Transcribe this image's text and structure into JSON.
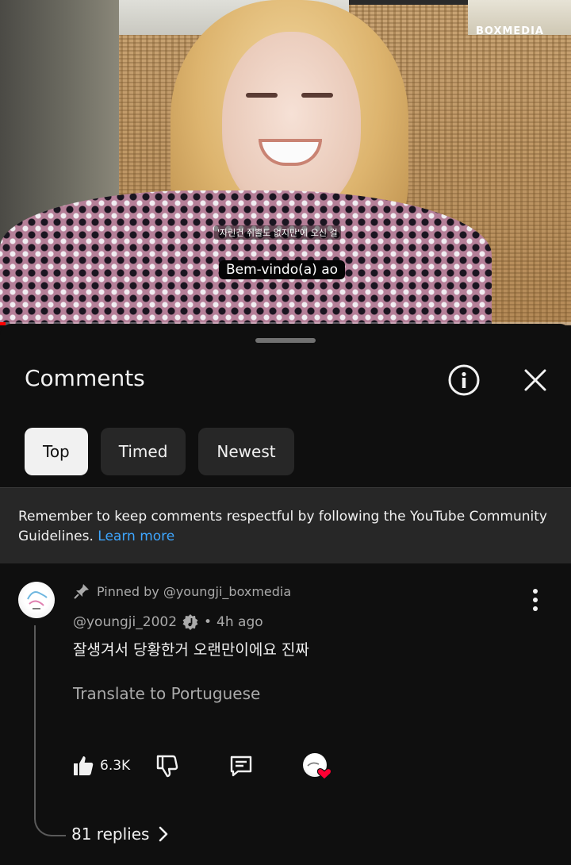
{
  "video": {
    "logo": "BOXMEDIA",
    "subtitle_korean": "'자린건 쥐뿔도 없지만'에 오신 걸",
    "caption": "Bem-vindo(a) ao",
    "progress": 0.01
  },
  "comments_panel": {
    "title": "Comments",
    "info_icon": "info-icon",
    "close_icon": "close-icon",
    "filters": [
      {
        "label": "Top",
        "active": true
      },
      {
        "label": "Timed",
        "active": false
      },
      {
        "label": "Newest",
        "active": false
      }
    ],
    "notice": {
      "text": "Remember to keep comments respectful by following the YouTube Community Guidelines.",
      "link": "Learn more"
    }
  },
  "comment": {
    "pinned_label": "Pinned by @youngji_boxmedia",
    "author": "@youngji_2002",
    "separator": "•",
    "time": "4h ago",
    "text": "잘생겨서 당황한거 오랜만이에요 진짜",
    "translate": "Translate to Portuguese",
    "likes": "6.3K",
    "replies": "81 replies",
    "colors": {
      "heart": "#ff0033",
      "link": "#3ea6ff"
    }
  }
}
